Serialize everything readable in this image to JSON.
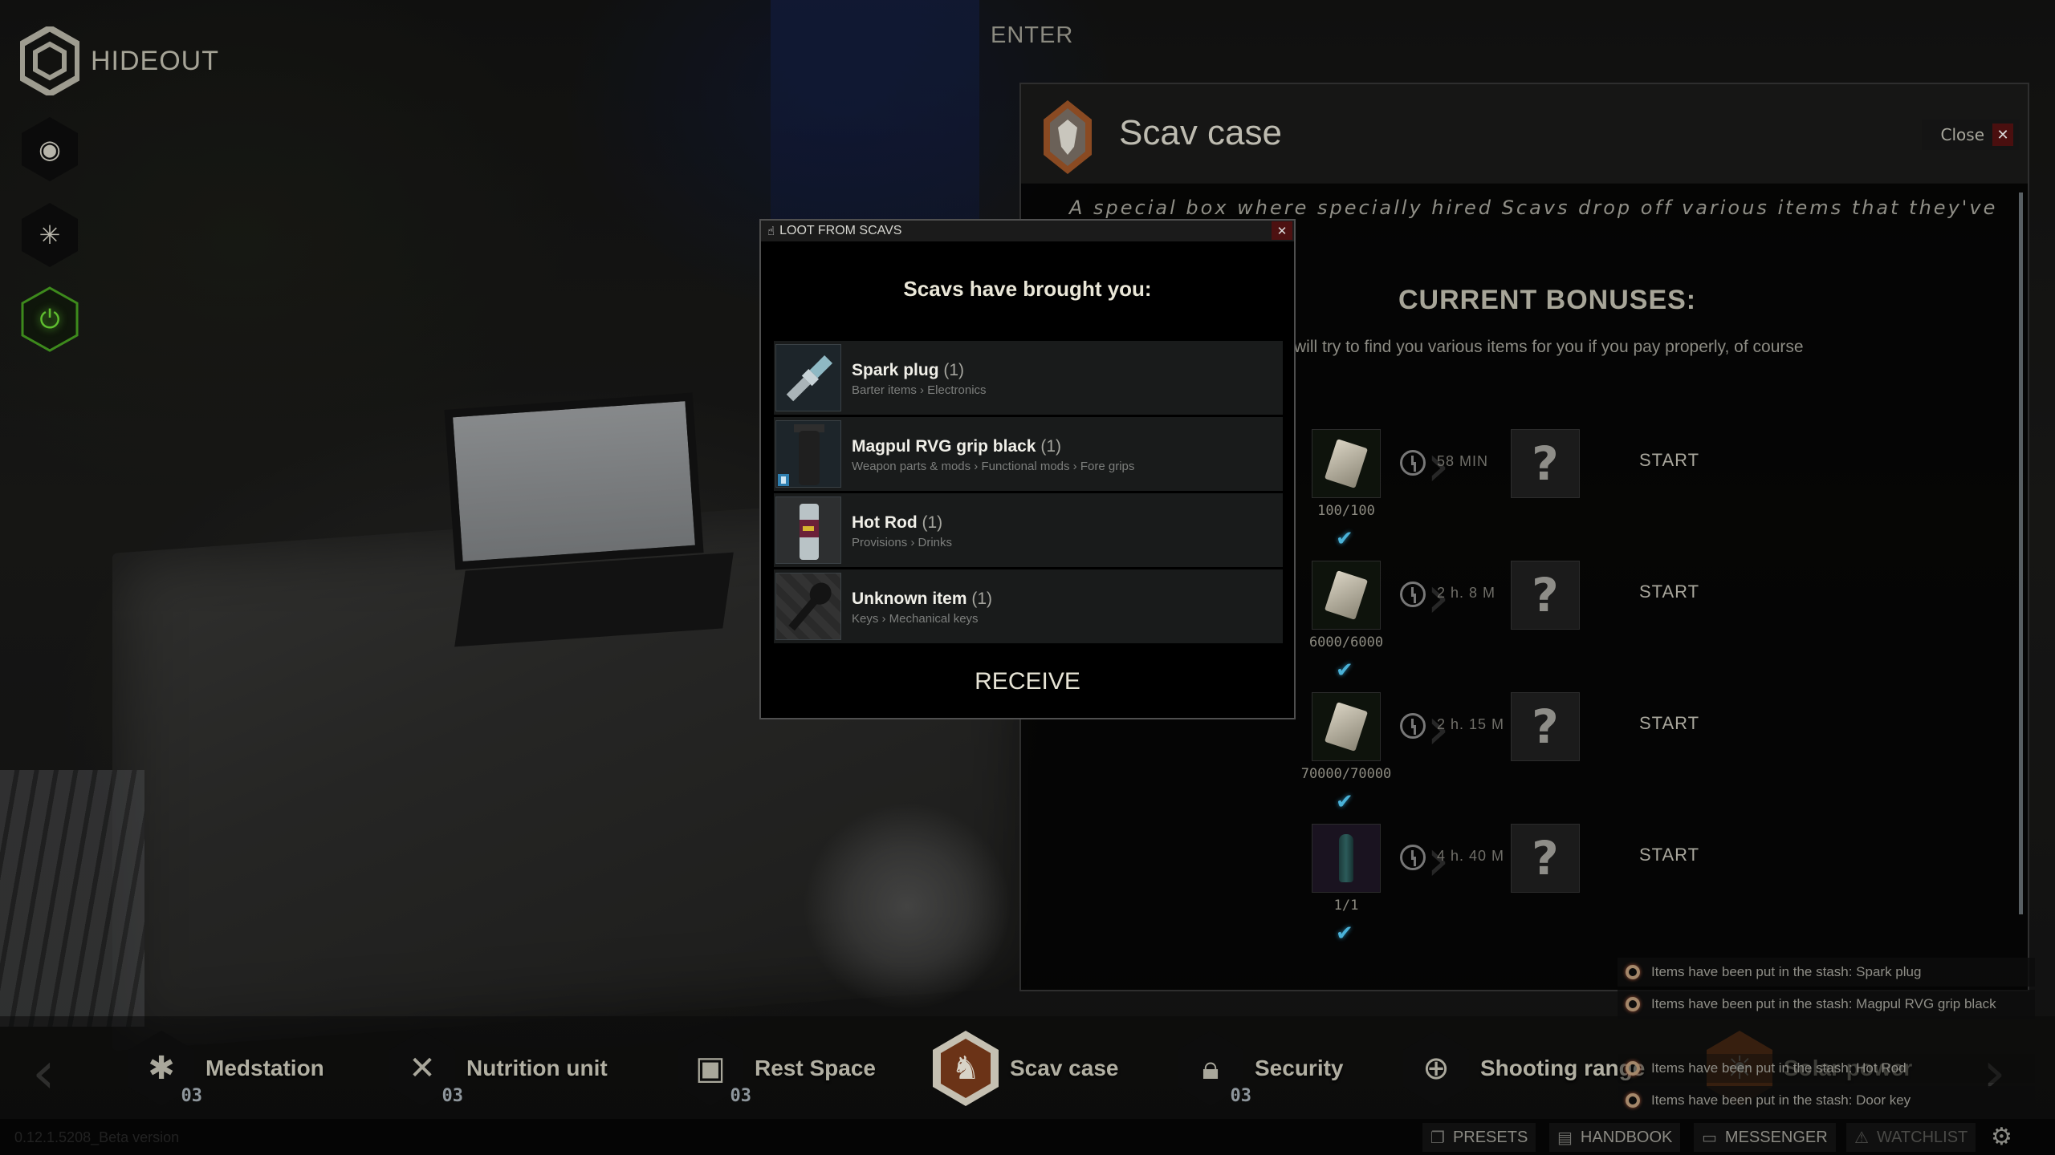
{
  "app": {
    "title": "HIDEOUT",
    "version": "0.12.1.5208_Beta version"
  },
  "top": {
    "enter_label": "ENTER"
  },
  "sidebar": {
    "buttons": [
      {
        "name": "night-vision-toggle",
        "icon": "night-vision-icon"
      },
      {
        "name": "light-toggle",
        "icon": "light-icon"
      },
      {
        "name": "generator-power-toggle",
        "icon": "power-icon",
        "active": true,
        "color": "#5fbf2f"
      }
    ]
  },
  "panel": {
    "title": "Scav case",
    "close_label": "Close",
    "description": "A special box where specially hired Scavs drop off various items that they've found.",
    "bonuses_title": "CURRENT BONUSES:",
    "bonuses_subtitle": "will try to find you various items for you if you pay properly, of course",
    "offers": [
      {
        "cost": "100/100",
        "time": "58 MIN",
        "reward": "?",
        "action": "START",
        "item": "roubles",
        "satisfied": true
      },
      {
        "cost": "6000/6000",
        "time": "2 h. 8 M",
        "reward": "?",
        "action": "START",
        "item": "roubles",
        "satisfied": true
      },
      {
        "cost": "70000/70000",
        "time": "2 h. 15 M",
        "reward": "?",
        "action": "START",
        "item": "roubles",
        "satisfied": true
      },
      {
        "cost": "1/1",
        "time": "4 h. 40 M",
        "reward": "?",
        "action": "START",
        "item": "bottle",
        "satisfied": true
      }
    ]
  },
  "dialog": {
    "title": "LOOT FROM SCAVS",
    "heading": "Scavs have brought you:",
    "items": [
      {
        "name": "Spark plug",
        "qty": "(1)",
        "path": "Barter items › Electronics"
      },
      {
        "name": "Magpul RVG grip black",
        "qty": "(1)",
        "path": "Weapon parts & mods › Functional mods › Fore grips"
      },
      {
        "name": "Hot Rod",
        "qty": "(1)",
        "path": "Provisions › Drinks"
      },
      {
        "name": "Unknown item",
        "qty": "(1)",
        "path": "Keys › Mechanical keys"
      }
    ],
    "receive_label": "RECEIVE"
  },
  "areas": [
    {
      "label": "Medstation",
      "level": "03",
      "icon": "medstation-icon"
    },
    {
      "label": "Nutrition unit",
      "level": "03",
      "icon": "nutrition-icon"
    },
    {
      "label": "Rest Space",
      "level": "03",
      "icon": "rest-space-icon"
    },
    {
      "label": "Scav case",
      "level": "",
      "icon": "scav-case-icon",
      "selected": true
    },
    {
      "label": "Security",
      "level": "03",
      "icon": "security-icon"
    },
    {
      "label": "Shooting range",
      "level": "",
      "icon": "shooting-range-icon"
    },
    {
      "label": "Solar power",
      "level": "",
      "icon": "solar-power-icon"
    }
  ],
  "notifications": [
    "Items have been put in the stash: Spark plug",
    "Items have been put in the stash: Magpul RVG grip black",
    "Items have been put in the stash: Hot Rod",
    "Items have been put in the stash: Door key"
  ],
  "footer": {
    "presets": "PRESETS",
    "handbook": "HANDBOOK",
    "messenger": "MESSENGER",
    "watchlist": "WATCHLIST"
  },
  "colors": {
    "accent_check": "#4ab2d8",
    "close_red": "#4d1111",
    "scav_orange": "#8a4a22",
    "power_green": "#5fbf2f"
  }
}
